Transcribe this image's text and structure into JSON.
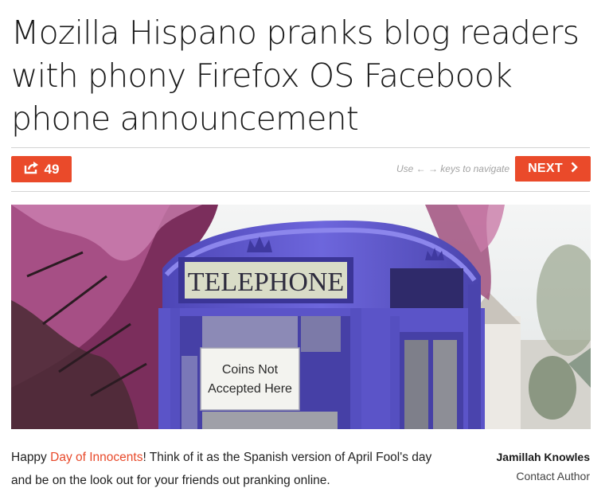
{
  "article": {
    "headline": "Mozilla Hispano pranks blog readers with phony Firefox OS Facebook phone announcement",
    "body_prefix": "Happy ",
    "body_link": "Day of Innocents",
    "body_suffix": "! Think of it as the Spanish version of April Fool's day and be on the look out for your friends out pranking online."
  },
  "toolbar": {
    "share_count": "49",
    "nav_hint": "Use ← → keys to navigate",
    "next_label": "NEXT"
  },
  "photo": {
    "sign_text": "TELEPHONE",
    "notice_line1": "Coins Not",
    "notice_line2": "Accepted Here"
  },
  "author": {
    "name": "Jamillah Knowles",
    "contact_label": "Contact Author"
  },
  "colors": {
    "accent": "#ea4a2a",
    "link": "#e8492a",
    "booth": "#6a63d6"
  },
  "icons": {
    "share": "share-arrow-icon",
    "next": "chevron-right-icon"
  }
}
